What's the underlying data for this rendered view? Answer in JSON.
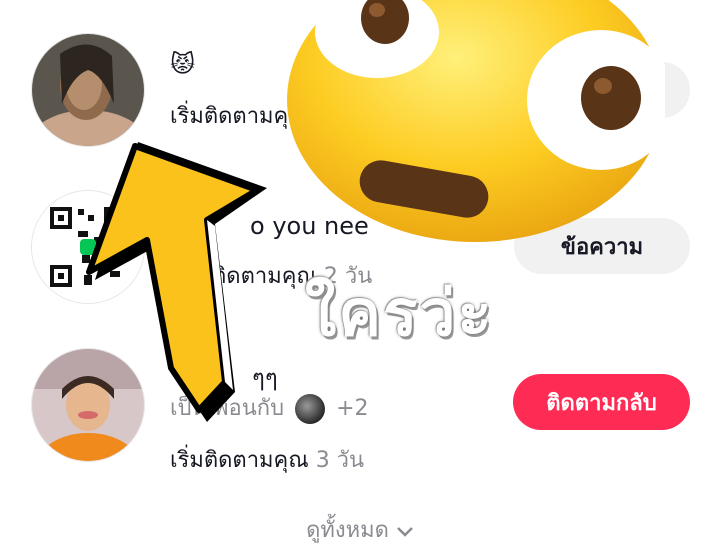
{
  "notifications": [
    {
      "name": "😾",
      "action": "เริ่มติดตามคุณ",
      "time": "",
      "button_label": ""
    },
    {
      "name": "o you nee",
      "action": "ติดตามคุณ",
      "time": "2 วัน",
      "button_label": "ข้อความ"
    },
    {
      "name": "ๆๆ",
      "mutual_prefix": "เป็นเพื่อนกับ",
      "mutual_extra": "+2",
      "action": "เริ่มติดตามคุณ",
      "time": "3 วัน",
      "button_label": "ติดตามกลับ"
    }
  ],
  "see_all": {
    "label": "ดูทั้งหมด",
    "icon": "chevron-down-icon"
  },
  "overlay": {
    "text": "ใครว่ะ",
    "emoji_icon": "flushed-face-emoji",
    "arrow_icon": "yellow-arrow-up-left",
    "arrow_color": "#fbc21c",
    "emoji_color": "#fdcc22"
  },
  "colors": {
    "follow_back": "#fe2c55",
    "message_button_bg": "#f1f1f2",
    "muted_text": "#8a8b91"
  }
}
